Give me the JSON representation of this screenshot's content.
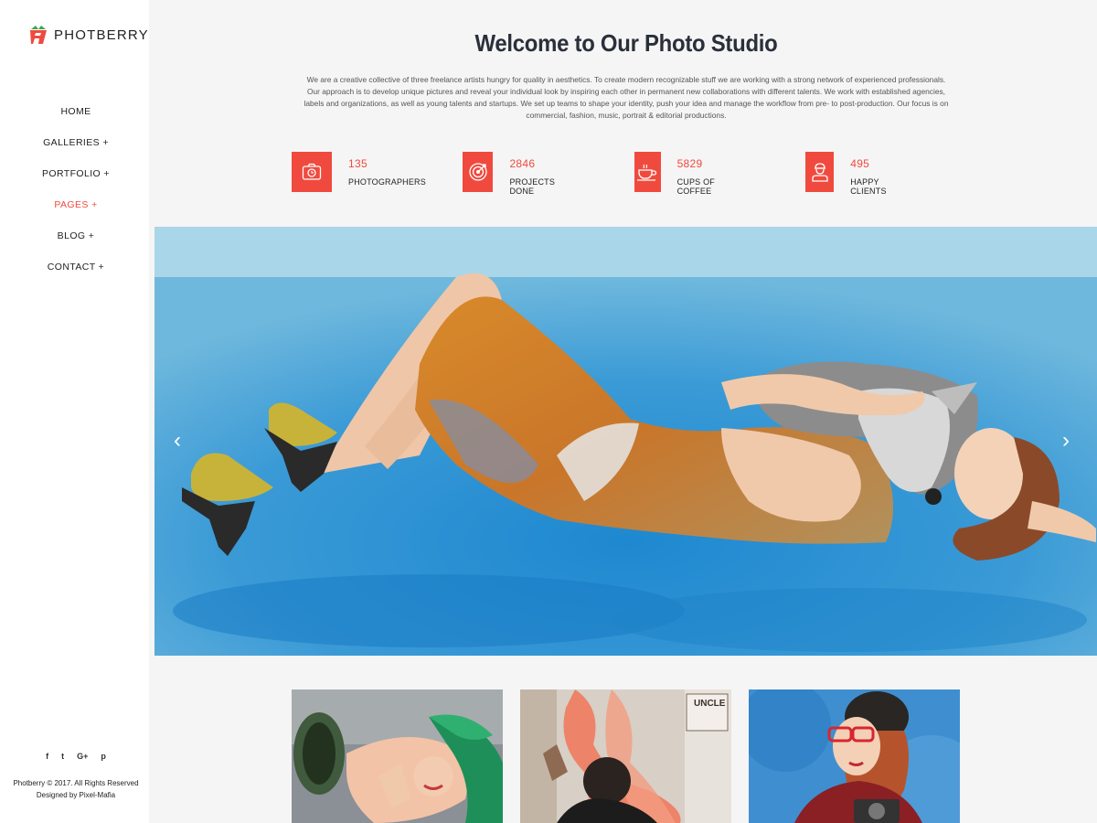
{
  "brand": {
    "name": "PHOTBERRY"
  },
  "nav": {
    "items": [
      {
        "label": "HOME"
      },
      {
        "label": "GALLERIES +"
      },
      {
        "label": "PORTFOLIO +"
      },
      {
        "label": "PAGES +"
      },
      {
        "label": "BLOG +"
      },
      {
        "label": "CONTACT +"
      }
    ],
    "active_index": 3
  },
  "social": {
    "icons": [
      "facebook-icon",
      "twitter-icon",
      "google-plus-icon",
      "pinterest-icon"
    ],
    "glyphs": [
      "f",
      "t",
      "G+",
      "p"
    ]
  },
  "footer": {
    "copyright": "Photberry © 2017. All Rights Reserved",
    "designed_by": "Designed by Pixel-Mafia"
  },
  "main": {
    "title": "Welcome to Our Photo Studio",
    "intro": "We are a creative collective of three freelance artists hungry for quality in aesthetics. To create modern recognizable stuff we are working with a strong network of experienced professionals. Our approach is to develop unique pictures and reveal your individual look by inspiring each other in permanent new collaborations with different talents. We work with established agencies, labels and organizations, as well as young talents and startups. We set up teams to shape your identity, push your idea and manage the workflow from pre- to post-production. Our focus is on commercial, fashion, music, portrait & editorial productions."
  },
  "stats": [
    {
      "value": "135",
      "label": "PHOTOGRAPHERS",
      "icon": "camera-icon"
    },
    {
      "value": "2846",
      "label": "PROJECTS DONE",
      "icon": "target-icon"
    },
    {
      "value": "5829",
      "label": "CUPS OF COFFEE",
      "icon": "coffee-cup-icon"
    },
    {
      "value": "495",
      "label": "HAPPY CLIENTS",
      "icon": "client-icon"
    }
  ],
  "slider": {
    "prev_glyph": "‹",
    "next_glyph": "›"
  },
  "gallery": {
    "sign_text": "UNCLE"
  },
  "colors": {
    "accent": "#f04a3e",
    "sidebar_bg": "#ffffff",
    "page_bg": "#f5f5f5",
    "title": "#2a2f3a"
  }
}
